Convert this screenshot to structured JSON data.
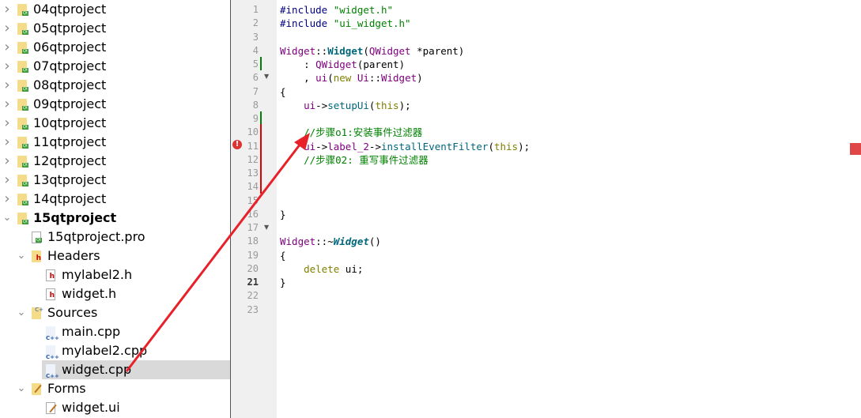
{
  "tree": [
    {
      "label": "04qtproject",
      "icon": "qt-project-folder-icon",
      "expander": "collapsed",
      "level": 0
    },
    {
      "label": "05qtproject",
      "icon": "qt-project-folder-icon",
      "expander": "collapsed",
      "level": 0
    },
    {
      "label": "06qtproject",
      "icon": "qt-project-folder-icon",
      "expander": "collapsed",
      "level": 0
    },
    {
      "label": "07qtproject",
      "icon": "qt-project-folder-icon",
      "expander": "collapsed",
      "level": 0
    },
    {
      "label": "08qtproject",
      "icon": "qt-project-folder-icon",
      "expander": "collapsed",
      "level": 0
    },
    {
      "label": "09qtproject",
      "icon": "qt-project-folder-icon",
      "expander": "collapsed",
      "level": 0
    },
    {
      "label": "10qtproject",
      "icon": "qt-project-folder-icon",
      "expander": "collapsed",
      "level": 0
    },
    {
      "label": "11qtproject",
      "icon": "qt-project-folder-icon",
      "expander": "collapsed",
      "level": 0
    },
    {
      "label": "12qtproject",
      "icon": "qt-project-folder-icon",
      "expander": "collapsed",
      "level": 0
    },
    {
      "label": "13qtproject",
      "icon": "qt-project-folder-icon",
      "expander": "collapsed",
      "level": 0
    },
    {
      "label": "14qtproject",
      "icon": "qt-project-folder-icon",
      "expander": "collapsed",
      "level": 0
    },
    {
      "label": "15qtproject",
      "icon": "qt-project-folder-icon",
      "expander": "expanded",
      "level": 0,
      "bold": true
    },
    {
      "label": "15qtproject.pro",
      "icon": "pro-file-icon",
      "expander": "none",
      "level": 1
    },
    {
      "label": "Headers",
      "icon": "headers-folder-icon",
      "expander": "expanded",
      "level": 1
    },
    {
      "label": "mylabel2.h",
      "icon": "header-file-icon",
      "expander": "none",
      "level": 2
    },
    {
      "label": "widget.h",
      "icon": "header-file-icon",
      "expander": "none",
      "level": 2
    },
    {
      "label": "Sources",
      "icon": "sources-folder-icon",
      "expander": "expanded",
      "level": 1
    },
    {
      "label": "main.cpp",
      "icon": "cpp-file-icon",
      "expander": "none",
      "level": 2
    },
    {
      "label": "mylabel2.cpp",
      "icon": "cpp-file-icon",
      "expander": "none",
      "level": 2
    },
    {
      "label": "widget.cpp",
      "icon": "cpp-file-icon",
      "expander": "none",
      "level": 2,
      "selected": true
    },
    {
      "label": "Forms",
      "icon": "forms-folder-icon",
      "expander": "expanded",
      "level": 1
    },
    {
      "label": "widget.ui",
      "icon": "ui-file-icon",
      "expander": "none",
      "level": 2
    }
  ],
  "editor": {
    "current_line": 21,
    "lines": [
      [
        [
          "#include ",
          "pp"
        ],
        [
          "\"widget.h\"",
          "str"
        ]
      ],
      [
        [
          "#include ",
          "pp"
        ],
        [
          "\"ui_widget.h\"",
          "str"
        ]
      ],
      [],
      [
        [
          "Widget",
          "cls"
        ],
        [
          "::",
          ""
        ],
        [
          "Widget",
          "fn b"
        ],
        [
          "(",
          ""
        ],
        [
          "QWidget",
          "cls"
        ],
        [
          " *parent)",
          ""
        ]
      ],
      [
        [
          "    : ",
          ""
        ],
        [
          "QWidget",
          "cls"
        ],
        [
          "(parent)",
          ""
        ]
      ],
      [
        [
          "    , ",
          ""
        ],
        [
          "ui",
          "cls"
        ],
        [
          "(",
          ""
        ],
        [
          "new",
          "kw"
        ],
        [
          " ",
          ""
        ],
        [
          "Ui",
          "cls"
        ],
        [
          "::",
          ""
        ],
        [
          "Widget",
          "cls"
        ],
        [
          ")",
          ""
        ]
      ],
      [
        [
          "{",
          ""
        ]
      ],
      [
        [
          "    ",
          ""
        ],
        [
          "ui",
          "cls"
        ],
        [
          "->",
          ""
        ],
        [
          "setupUi",
          "fn"
        ],
        [
          "(",
          ""
        ],
        [
          "this",
          "kw"
        ],
        [
          ");",
          ""
        ]
      ],
      [],
      [
        [
          "    //步骤o1:安装事件过滤器",
          "cm"
        ]
      ],
      [
        [
          "    ",
          ""
        ],
        [
          "ui",
          "cls"
        ],
        [
          "->",
          ""
        ],
        [
          "label_2",
          "cls"
        ],
        [
          "->",
          ""
        ],
        [
          "installEventFilter",
          "fn"
        ],
        [
          "(",
          ""
        ],
        [
          "this",
          "kw"
        ],
        [
          ");",
          ""
        ]
      ],
      [
        [
          "    //步骤02: 重写事件过滤器",
          "cm"
        ]
      ],
      [],
      [],
      [],
      [
        [
          "}",
          ""
        ]
      ],
      [],
      [
        [
          "Widget",
          "cls"
        ],
        [
          "::~",
          ""
        ],
        [
          "Widget",
          "fn b it"
        ],
        [
          "()",
          ""
        ]
      ],
      [
        [
          "{",
          ""
        ]
      ],
      [
        [
          "    ",
          ""
        ],
        [
          "delete",
          "kw"
        ],
        [
          " ui;",
          ""
        ]
      ],
      [
        [
          "}",
          ""
        ]
      ],
      [],
      []
    ],
    "error_line": 11,
    "colors": {
      "annotation_arrow": "#e8202a",
      "modified_marker": "#008000",
      "error_marker": "#e04040"
    }
  }
}
